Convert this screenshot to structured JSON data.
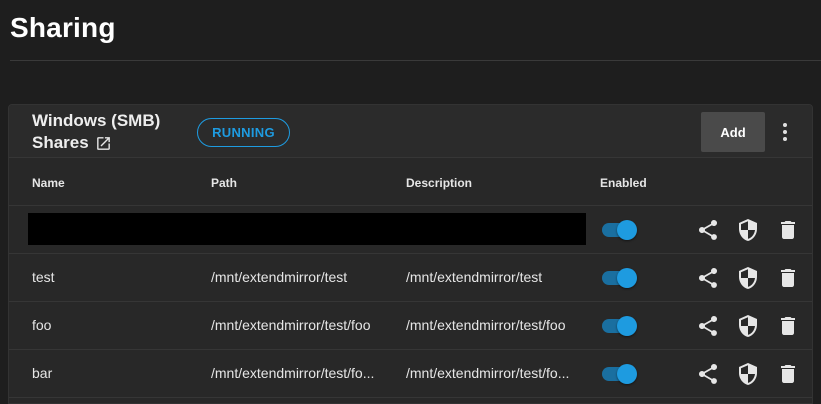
{
  "page": {
    "title": "Sharing"
  },
  "card": {
    "title_line1": "Windows (SMB)",
    "title_line2": "Shares",
    "status": "RUNNING",
    "add_label": "Add",
    "accent": "#1e9be0"
  },
  "table": {
    "columns": [
      "Name",
      "Path",
      "Description",
      "Enabled"
    ],
    "rows": [
      {
        "name": "",
        "path": "",
        "description": "",
        "enabled": true,
        "redacted": true
      },
      {
        "name": "test",
        "path": "/mnt/extendmirror/test",
        "description": "/mnt/extendmirror/test",
        "enabled": true
      },
      {
        "name": "foo",
        "path": "/mnt/extendmirror/test/foo",
        "description": "/mnt/extendmirror/test/foo",
        "enabled": true
      },
      {
        "name": "bar",
        "path": "/mnt/extendmirror/test/fo...",
        "description": "/mnt/extendmirror/test/fo...",
        "enabled": true
      }
    ]
  },
  "icons": {
    "external": "open-in-new-icon",
    "menu": "more-vert-icon",
    "share": "share-icon",
    "permissions": "security-shield-icon",
    "delete": "delete-icon"
  }
}
